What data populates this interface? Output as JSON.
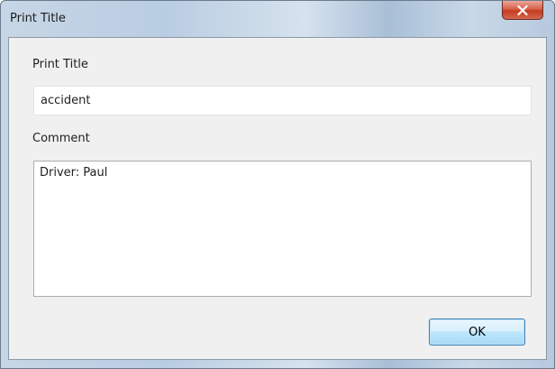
{
  "window": {
    "title": "Print Title",
    "close_icon": "close-icon"
  },
  "form": {
    "print_title_label": "Print Title",
    "print_title_value": "accident",
    "comment_label": "Comment",
    "comment_value": "Driver: Paul"
  },
  "buttons": {
    "ok_label": "OK"
  },
  "colors": {
    "close_button": "#c53b22",
    "ok_button_border": "#3c7fb1",
    "client_background": "#f0f0f0"
  }
}
